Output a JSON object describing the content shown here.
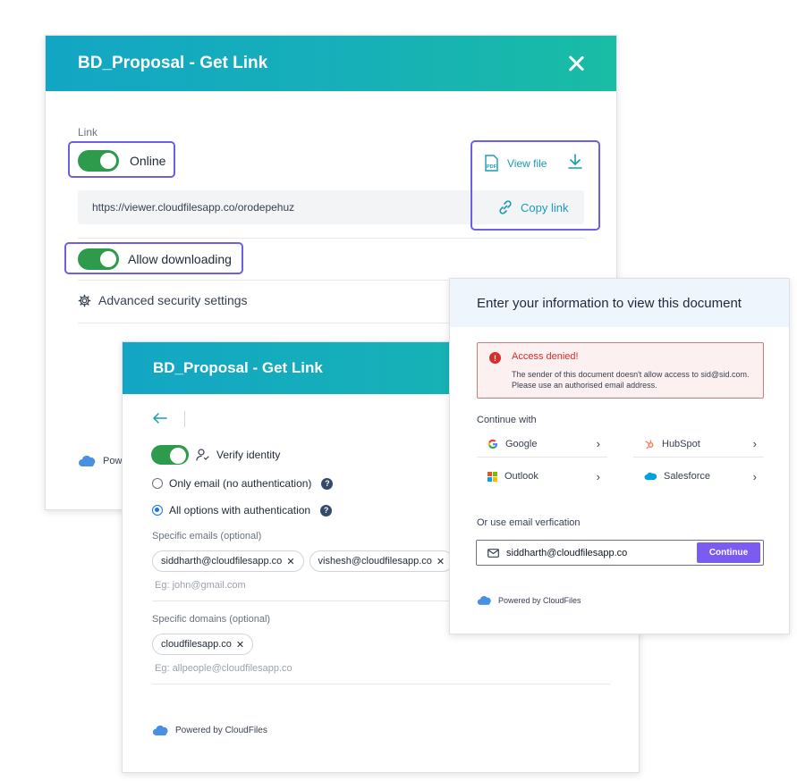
{
  "dialog1": {
    "title": "BD_Proposal - Get Link",
    "link_label": "Link",
    "online_label": "Online",
    "view_file_label": "View file",
    "url": "https://viewer.cloudfilesapp.co/orodepehuz",
    "copy_link_label": "Copy link",
    "allow_downloading_label": "Allow downloading",
    "advanced_label": "Advanced security settings",
    "powered_partial": "Powe"
  },
  "dialog2": {
    "title": "BD_Proposal - Get Link",
    "verify_label": "Verify identity",
    "option_email": "Only email (no authentication)",
    "option_all": "All options with authentication",
    "specific_emails_label": "Specific emails (optional)",
    "emails": [
      "siddharth@cloudfilesapp.co",
      "vishesh@cloudfilesapp.co"
    ],
    "emails_placeholder": "Eg: john@gmail.com",
    "specific_domains_label": "Specific domains (optional)",
    "domains": [
      "cloudfilesapp.co"
    ],
    "domains_placeholder": "Eg: allpeople@cloudfilesapp.co",
    "powered": "Powered by CloudFiles"
  },
  "dialog3": {
    "title": "Enter your information to view this document",
    "error_title": "Access denied!",
    "error_message": "The sender of this document doesn't allow access to sid@sid.com. Please use an authorised email address.",
    "continue_with": "Continue with",
    "providers": [
      "Google",
      "HubSpot",
      "Outlook",
      "Salesforce"
    ],
    "email_verify_label": "Or use email verfication",
    "email_value": "siddharth@cloudfilesapp.co",
    "continue_button": "Continue",
    "powered": "Powered by CloudFiles"
  },
  "colors": {
    "header_gradient_start": "#13a6c4",
    "header_gradient_end": "#19bca4",
    "toggle_on": "#2e9a4b",
    "highlight": "#6d5ee8",
    "continue_button": "#7a5cf0",
    "error": "#d32f2f"
  }
}
